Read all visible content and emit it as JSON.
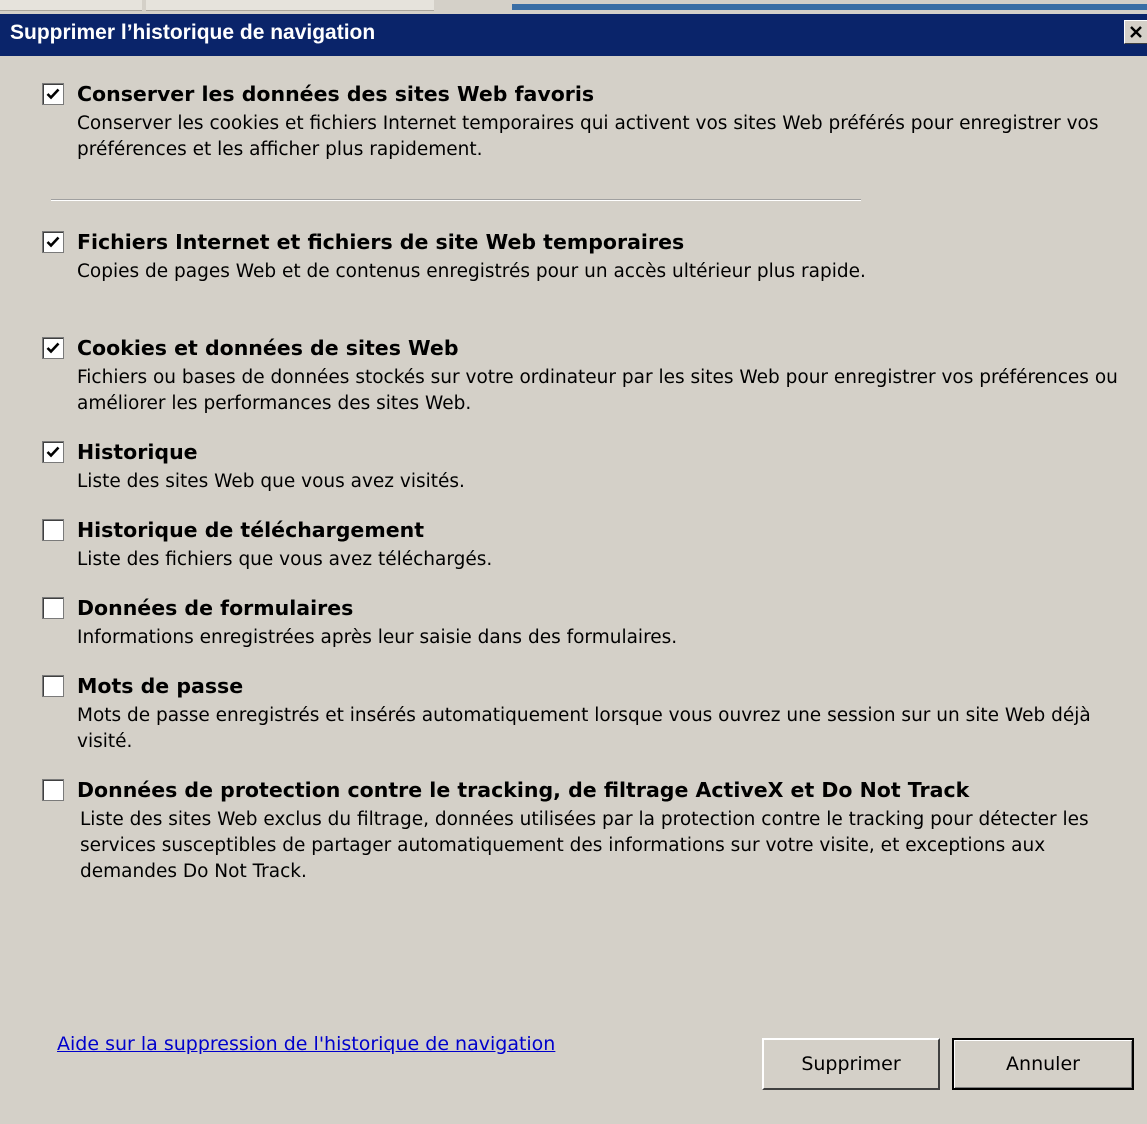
{
  "dialog": {
    "title": "Supprimer l’historique de navigation"
  },
  "options": [
    {
      "title": "Conserver les données des sites Web favoris",
      "description": "Conserver les cookies et fichiers Internet temporaires qui activent vos sites Web préférés pour enregistrer vos préférences et les afficher plus rapidement.",
      "checked": true
    },
    {
      "title": "Fichiers Internet et fichiers de site Web temporaires",
      "description": "Copies de pages Web et de contenus enregistrés pour un accès ultérieur plus rapide.",
      "checked": true
    },
    {
      "title": "Cookies et données de sites Web",
      "description": "Fichiers ou bases de données stockés sur votre ordinateur par les sites Web pour enregistrer vos préférences ou améliorer les performances des sites Web.",
      "checked": true
    },
    {
      "title": "Historique",
      "description": "Liste des sites Web que vous avez visités.",
      "checked": true
    },
    {
      "title": "Historique de téléchargement",
      "description": "Liste des fichiers que vous avez téléchargés.",
      "checked": false
    },
    {
      "title": "Données de formulaires",
      "description": "Informations enregistrées après leur saisie dans des formulaires.",
      "checked": false
    },
    {
      "title": "Mots de passe",
      "description": "Mots de passe enregistrés et insérés automatiquement lorsque vous ouvrez une session sur un site Web déjà visité.",
      "checked": false
    },
    {
      "title": "Données de protection contre le tracking, de filtrage ActiveX et Do Not Track",
      "description": "Liste des sites Web exclus du filtrage, données utilisées par la protection contre le tracking pour détecter les services susceptibles de partager automatiquement des informations sur votre visite, et exceptions aux demandes Do Not Track.",
      "checked": false
    }
  ],
  "footer": {
    "help_link": "Aide sur la suppression de l'historique de navigation",
    "delete_label": "Supprimer",
    "cancel_label": "Annuler"
  },
  "icons": {
    "close": "close-icon",
    "check": "checkmark-icon"
  },
  "colors": {
    "titlebar": "#0a246a",
    "dialog_background": "#d4d0c8",
    "link": "#0000cc"
  }
}
